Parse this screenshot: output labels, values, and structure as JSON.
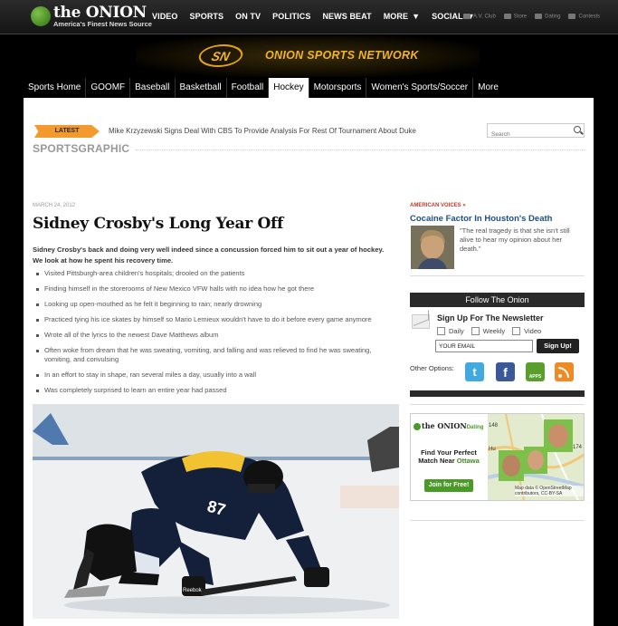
{
  "brand": {
    "name": "the ONION",
    "tagline": "America's Finest News Source"
  },
  "topnav": {
    "items": [
      "VIDEO",
      "SPORTS",
      "ON TV",
      "POLITICS",
      "NEWS BEAT",
      "MORE",
      "SOCIAL"
    ],
    "util": [
      "A.V. Club",
      "Store",
      "Dating",
      "Contests"
    ]
  },
  "banner": {
    "badge": "SN",
    "title": "ONION SPORTS NETWORK"
  },
  "sportsnav": {
    "items": [
      "Sports Home",
      "GOOMF",
      "Baseball",
      "Basketball",
      "Football",
      "Hockey",
      "Motorsports",
      "Women's Sports/Soccer",
      "More"
    ],
    "active_index": 5
  },
  "latest": {
    "tag": "LATEST",
    "text": "Mike Krzyzewski Signs Deal With CBS To Provide Analysis For Rest Of Tournament About Duke"
  },
  "search": {
    "placeholder": "Search"
  },
  "section": {
    "title": "SPORTSGRAPHIC"
  },
  "article": {
    "date": "MARCH 24, 2012",
    "headline": "Sidney Crosby's Long Year Off",
    "lede": "Sidney Crosby's back and doing very well indeed since a concussion forced him to sit out a year of hockey. We look at how he spent his recovery time.",
    "bullets": [
      "Visited Pittsburgh-area children's hospitals; drooled on the patients",
      "Finding himself in the storerooms of New Mexico VFW halls with no idea how he got there",
      "Looking up open-mouthed as he felt it beginning to rain; nearly drowning",
      "Practiced tying his ice skates by himself so Mario Lemieux wouldn't have to do it before every game anymore",
      "Wrote all of the lyrics to the newest Dave Matthews album",
      "Often woke from dream that he was sweating, vomiting, and falling and was relieved to find he was sweating, vomiting, and convulsing",
      "In an effort to stay in shape, ran several miles a day, usually into a wall",
      "Was completely surprised to learn an entire year had passed"
    ],
    "photo": {
      "jersey_number": "87",
      "glove_brand": "Reebok"
    }
  },
  "american_voices": {
    "label": "AMERICAN VOICES »",
    "title": "Cocaine Factor In Houston's Death",
    "quote": "\"The real tragedy is that she isn't still alive to hear my opinion about her death.\""
  },
  "follow": {
    "title": "Follow The Onion",
    "newsletter_title": "Sign Up For The Newsletter",
    "options": [
      "Daily",
      "Weekly",
      "Video"
    ],
    "email_value": "YOUR EMAIL",
    "signup_label": "Sign Up!",
    "other_options_label": "Other Options:",
    "social": [
      "twitter-icon",
      "facebook-icon",
      "apps-icon",
      "rss-icon"
    ],
    "apps_label": "APPS"
  },
  "ad": {
    "brand": "the ONION",
    "brand_suffix": "Dating",
    "find_text": "Find Your Perfect Match Near",
    "city": "Ottawa",
    "button": "Join for Free!",
    "map_credit": "Map data © OpenStreetMap contributors, CC-BY-SA",
    "map_labels": [
      "148",
      "174",
      "Hu"
    ]
  },
  "colors": {
    "accent_orange": "#f29a2e",
    "link_blue": "#1d4e89",
    "voices_red": "#c0392b",
    "dating_green": "#4a9a28",
    "banner_gold": "#f2b327"
  }
}
